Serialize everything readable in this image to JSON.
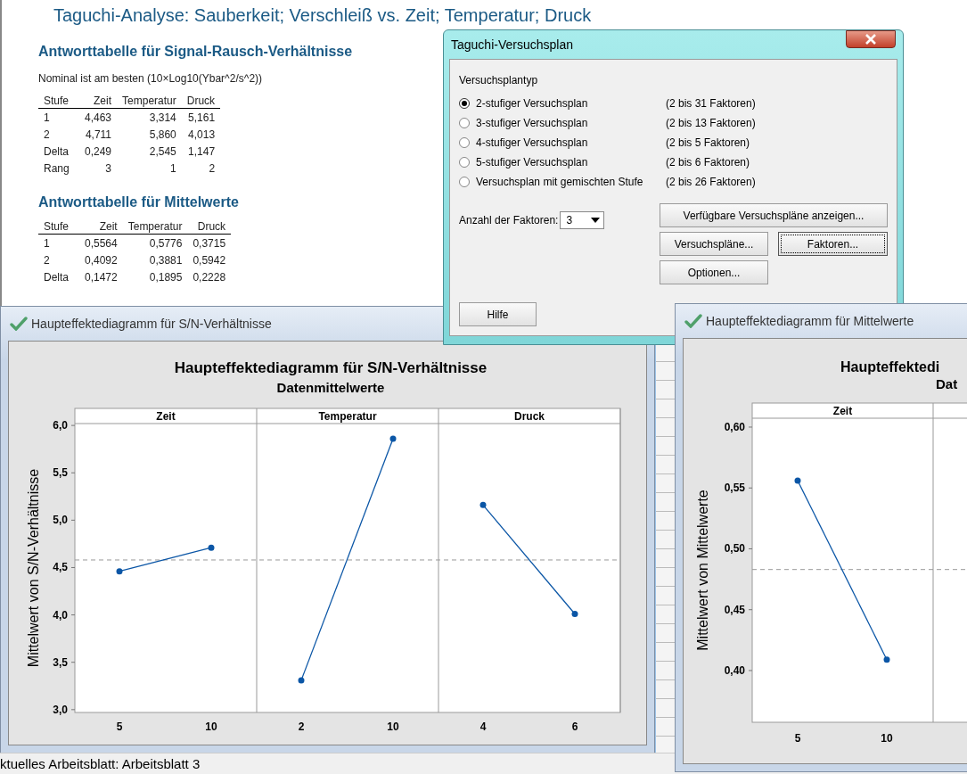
{
  "session": {
    "title": "Taguchi-Analyse: Sauberkeit; Verschleiß vs. Zeit; Temperatur; Druck",
    "tables": [
      {
        "heading": "Antworttabelle für Signal-Rausch-Verhältnisse",
        "note": "Nominal ist am besten (10×Log10(Ybar^2/s^2))",
        "columns": [
          "Stufe",
          "Zeit",
          "Temperatur",
          "Druck"
        ],
        "rows": [
          [
            "1",
            "4,463",
            "3,314",
            "5,161"
          ],
          [
            "2",
            "4,711",
            "5,860",
            "4,013"
          ],
          [
            "Delta",
            "0,249",
            "2,545",
            "1,147"
          ],
          [
            "Rang",
            "3",
            "1",
            "2"
          ]
        ]
      },
      {
        "heading": "Antworttabelle für Mittelwerte",
        "columns": [
          "Stufe",
          "Zeit",
          "Temperatur",
          "Druck"
        ],
        "rows": [
          [
            "1",
            "0,5564",
            "0,5776",
            "0,3715"
          ],
          [
            "2",
            "0,4092",
            "0,3881",
            "0,5942"
          ],
          [
            "Delta",
            "0,1472",
            "0,1895",
            "0,2228"
          ]
        ]
      }
    ]
  },
  "dialog": {
    "title": "Taguchi-Versuchsplan",
    "group_label": "Versuchsplantyp",
    "options": [
      {
        "label": "2-stufiger Versuchsplan",
        "range": "(2 bis 31 Faktoren)",
        "selected": true
      },
      {
        "label": "3-stufiger Versuchsplan",
        "range": "(2 bis 13 Faktoren)",
        "selected": false
      },
      {
        "label": "4-stufiger Versuchsplan",
        "range": "(2 bis 5 Faktoren)",
        "selected": false
      },
      {
        "label": "5-stufiger Versuchsplan",
        "range": "(2 bis 6 Faktoren)",
        "selected": false
      },
      {
        "label": "Versuchsplan mit gemischten Stufe",
        "range": "(2 bis 26 Faktoren)",
        "selected": false
      }
    ],
    "factor_count": {
      "label": "Anzahl der Faktoren:",
      "value": "3"
    },
    "buttons": [
      {
        "label": "Verfügbare Versuchspläne anzeigen...",
        "focused": false
      },
      {
        "label": "Versuchspläne...",
        "focused": false
      },
      {
        "label": "Faktoren...",
        "focused": true
      },
      {
        "label": "Optionen...",
        "focused": false
      }
    ],
    "help_button": "Hilfe"
  },
  "chart_windows": [
    {
      "title": "Haupteffektediagramm für S/N-Verhältnisse",
      "subtitle": "Datenmittelwerte",
      "panels": [
        "Zeit",
        "Temperatur",
        "Druck"
      ],
      "chart_data": {
        "type": "line",
        "title": "Haupteffektediagramm für S/N-Verhältnisse",
        "ylabel": "Mittelwert von S/N-Verhältnisse",
        "categories": [
          "5",
          "10",
          "2",
          "10",
          "4",
          "6"
        ],
        "series": [
          {
            "color": "#0b56a6",
            "marker": "circle",
            "values": [
              4.46,
              4.71,
              null,
              null,
              null,
              null
            ]
          },
          {
            "color": "#0b56a6",
            "marker": "circle",
            "values": [
              null,
              null,
              3.31,
              5.86,
              null,
              null
            ]
          },
          {
            "color": "#0b56a6",
            "marker": "circle",
            "values": [
              null,
              null,
              null,
              null,
              5.16,
              4.01
            ]
          }
        ],
        "ylim": [
          2.97,
          6.02
        ],
        "yticks": [
          {
            "value": 3,
            "label": "3,0"
          },
          {
            "value": 3.5,
            "label": "3,5"
          },
          {
            "value": 4,
            "label": "4,0"
          },
          {
            "value": 4.5,
            "label": "4,5"
          },
          {
            "value": 5,
            "label": "5,0"
          },
          {
            "value": 5.5,
            "label": "5,5"
          },
          {
            "value": 6,
            "label": "6,0"
          }
        ],
        "ref_lines": [
          {
            "axis": "y",
            "value": 4.58
          }
        ]
      }
    },
    {
      "title": "Haupteffektediagramm für Mittelwerte",
      "subtitle": "Dat",
      "panels": [
        "Zeit"
      ],
      "chart_data": {
        "type": "line",
        "title": "Haupteffektedi",
        "ylabel": "Mittelwert von Mittelwerte",
        "categories": [
          "5",
          "10"
        ],
        "series": [
          {
            "color": "#0b56a6",
            "marker": "circle",
            "values": [
              0.556,
              0.409
            ]
          }
        ],
        "ylim": [
          0.3575,
          0.6073
        ],
        "yticks": [
          {
            "value": 0.4,
            "label": "0,40"
          },
          {
            "value": 0.45,
            "label": "0,45"
          },
          {
            "value": 0.5,
            "label": "0,50"
          },
          {
            "value": 0.55,
            "label": "0,55"
          },
          {
            "value": 0.6,
            "label": "0,60"
          }
        ],
        "ref_lines": [
          {
            "axis": "y",
            "value": 0.483
          }
        ]
      }
    }
  ],
  "status_bar": "ktuelles Arbeitsblatt: Arbeitsblatt 3"
}
